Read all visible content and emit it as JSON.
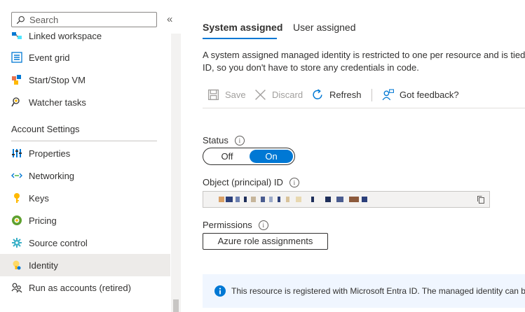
{
  "search": {
    "placeholder": "Search"
  },
  "sidebar": {
    "collapse_glyph": "«",
    "items_top": [
      {
        "label": "Linked workspace",
        "icon": "linked-workspace-icon"
      },
      {
        "label": "Event grid",
        "icon": "event-grid-icon"
      },
      {
        "label": "Start/Stop VM",
        "icon": "start-stop-vm-icon"
      },
      {
        "label": "Watcher tasks",
        "icon": "watcher-tasks-icon"
      }
    ],
    "section_title": "Account Settings",
    "items": [
      {
        "label": "Properties",
        "icon": "properties-icon"
      },
      {
        "label": "Networking",
        "icon": "networking-icon"
      },
      {
        "label": "Keys",
        "icon": "key-icon"
      },
      {
        "label": "Pricing",
        "icon": "pricing-icon"
      },
      {
        "label": "Source control",
        "icon": "source-control-icon"
      },
      {
        "label": "Identity",
        "icon": "identity-icon",
        "selected": true
      },
      {
        "label": "Run as accounts (retired)",
        "icon": "run-as-accounts-icon"
      }
    ]
  },
  "tabs": [
    {
      "label": "System assigned",
      "active": true
    },
    {
      "label": "User assigned",
      "active": false
    }
  ],
  "description": {
    "line1": "A system assigned managed identity is restricted to one per resource and is tied",
    "line2": "ID, so you don't have to store any credentials in code."
  },
  "toolbar": {
    "save": "Save",
    "discard": "Discard",
    "refresh": "Refresh",
    "feedback": "Got feedback?"
  },
  "status": {
    "label": "Status",
    "off": "Off",
    "on": "On",
    "value": "On"
  },
  "object_id": {
    "label": "Object (principal) ID"
  },
  "permissions": {
    "label": "Permissions",
    "button": "Azure role assignments"
  },
  "info_bar": {
    "text": "This resource is registered with Microsoft Entra ID. The managed identity can be"
  },
  "colors": {
    "accent": "#0078d4",
    "selected_bg": "#edebe9",
    "info_bg": "#f0f6ff"
  }
}
